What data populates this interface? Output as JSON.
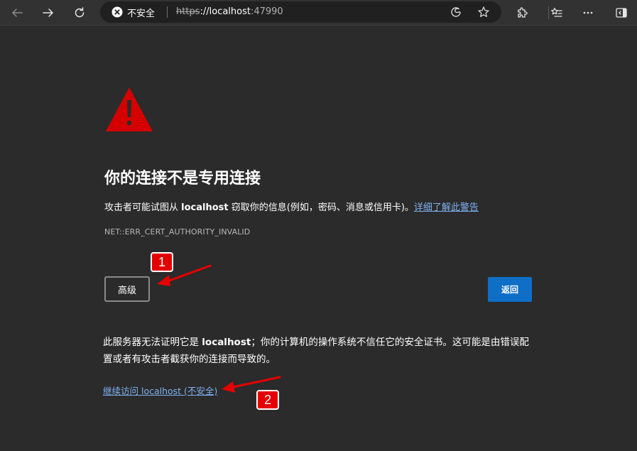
{
  "browser": {
    "security_label": "不安全",
    "url_scheme": "https",
    "url_host": "://localhost",
    "url_port": ":47990"
  },
  "page": {
    "title": "你的连接不是专用连接",
    "description_prefix": "攻击者可能试图从 ",
    "description_host": "localhost",
    "description_suffix": " 窃取你的信息(例如，密码、消息或信用卡)。",
    "learn_more_link": "详细了解此警告",
    "error_code": "NET::ERR_CERT_AUTHORITY_INVALID",
    "advanced_button": "高级",
    "back_button": "返回",
    "detail_prefix": "此服务器无法证明它是 ",
    "detail_host": "localhost",
    "detail_suffix": "；你的计算机的操作系统不信任它的安全证书。这可能是由错误配置或者有攻击者截获你的连接而导致的。",
    "proceed_link": "继续访问 localhost (不安全)"
  },
  "annotations": {
    "badge_1": "1",
    "badge_2": "2",
    "color": "#e50000"
  },
  "colors": {
    "background": "#2b2b2b",
    "link": "#7fb1f2",
    "primary_button": "#0f6fc6",
    "warning": "#d40000"
  }
}
